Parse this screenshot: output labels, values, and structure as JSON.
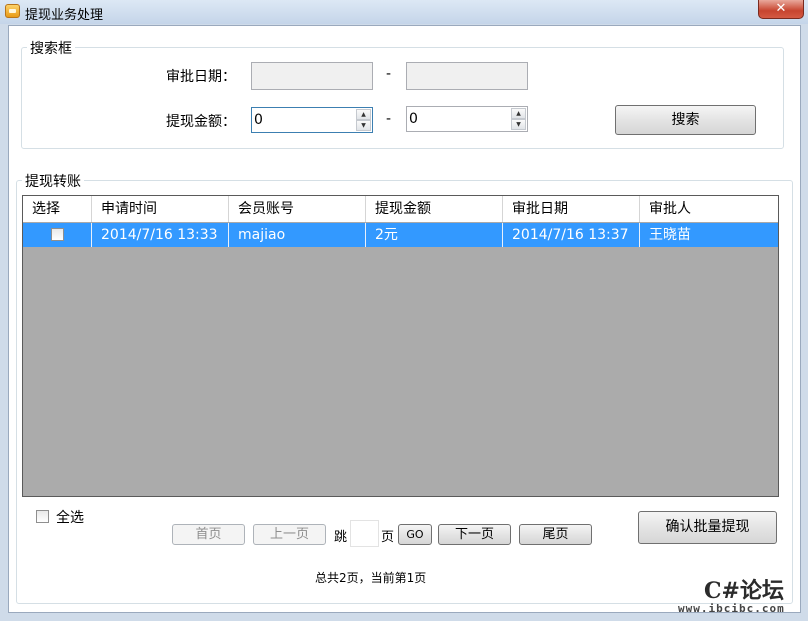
{
  "window": {
    "title": "提现业务处理",
    "close_label": "✕"
  },
  "search_box": {
    "legend": "搜索框",
    "approval_date_label": "审批日期：",
    "amount_label": "提现金额：",
    "dash": "-",
    "amount_from": "0",
    "amount_to": "0",
    "search_button": "搜索"
  },
  "transfer_group": {
    "legend": "提现转账",
    "columns": [
      "选择",
      "申请时间",
      "会员账号",
      "提现金额",
      "审批日期",
      "审批人"
    ],
    "rows": [
      {
        "selected": false,
        "apply_time": "2014/7/16 13:33",
        "account": "majiao",
        "amount": "2元",
        "approval_date": "2014/7/16 13:37",
        "approver": "王晓苗"
      }
    ]
  },
  "footer": {
    "select_all_label": "全选",
    "first_page": "首页",
    "prev_page": "上一页",
    "jump_label": "跳",
    "page_label": "页",
    "go_button": "GO",
    "next_page": "下一页",
    "last_page": "尾页",
    "confirm_button": "确认批量提现",
    "status": "总共2页，当前第1页"
  },
  "watermark": {
    "brand": "C#论坛",
    "url": "www.ibcibc.com"
  }
}
